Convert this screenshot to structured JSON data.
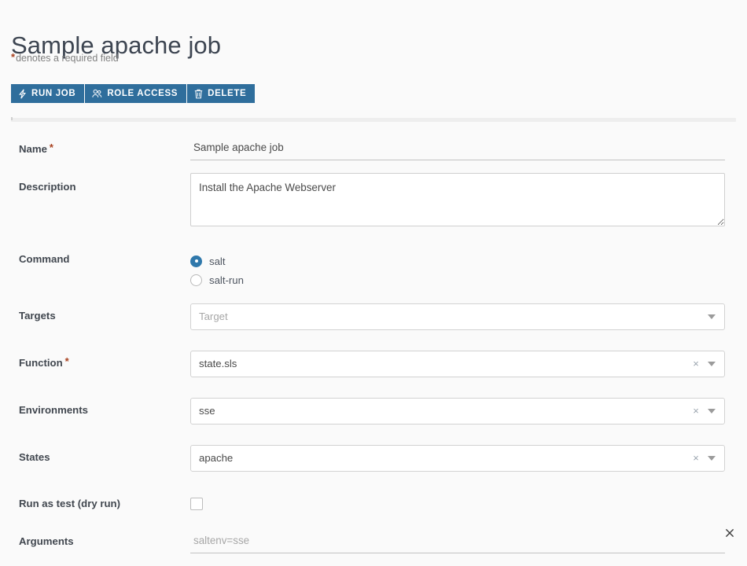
{
  "header": {
    "title": "Sample apache job",
    "required_note": "denotes a required field",
    "required_star": "*",
    "star_color": "#a8411f"
  },
  "theme": {
    "button_blue": "#2f6e9c",
    "radio_blue": "#2f78ab",
    "page_background": "#fafafa",
    "label_color": "#41474f"
  },
  "toolbar": {
    "buttons": [
      {
        "label": "RUN JOB",
        "icon": "lightning-bolt-icon"
      },
      {
        "label": "ROLE ACCESS",
        "icon": "user-group-icon"
      },
      {
        "label": "DELETE",
        "icon": "trash-icon"
      }
    ]
  },
  "form": {
    "name": {
      "label": "Name",
      "required": true,
      "value": "Sample apache job",
      "placeholder": ""
    },
    "description": {
      "label": "Description",
      "required": false,
      "value": "Install the Apache Webserver",
      "placeholder": ""
    },
    "command": {
      "label": "Command",
      "required": false,
      "selected": "salt",
      "options": [
        {
          "label": "salt",
          "selected": true
        },
        {
          "label": "salt-run",
          "selected": false
        }
      ]
    },
    "targets": {
      "label": "Targets",
      "required": false,
      "value": "",
      "placeholder": "Target",
      "clearable": false
    },
    "function": {
      "label": "Function",
      "required": true,
      "value": "state.sls",
      "placeholder": "",
      "clearable": true,
      "clear_glyph": "×"
    },
    "environments": {
      "label": "Environments",
      "required": false,
      "value": "sse",
      "placeholder": "",
      "clearable": true,
      "clear_glyph": "×"
    },
    "states": {
      "label": "States",
      "required": false,
      "value": "apache",
      "placeholder": "",
      "clearable": true,
      "clear_glyph": "×"
    },
    "dry_run": {
      "label": "Run as test (dry run)",
      "required": false,
      "checked": false
    },
    "arguments": {
      "label": "Arguments",
      "required": false,
      "value": "",
      "placeholder": "saltenv=sse"
    }
  }
}
